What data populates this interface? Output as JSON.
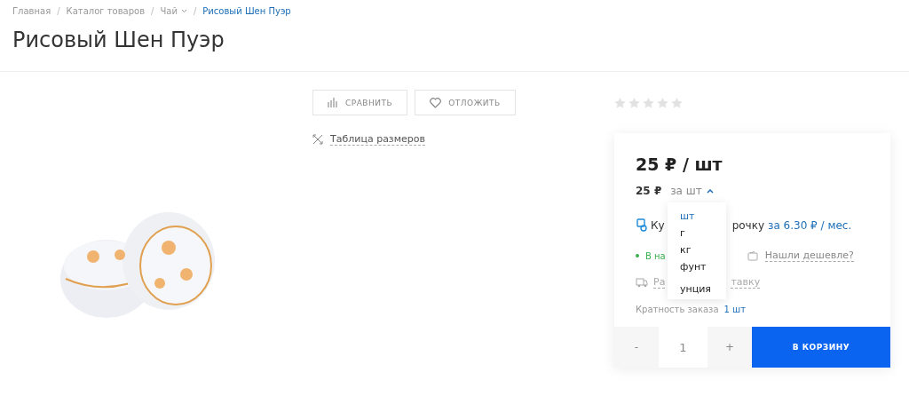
{
  "breadcrumb_separator": "/",
  "breadcrumbs": [
    {
      "label": "Главная",
      "current": false,
      "has_menu": false
    },
    {
      "label": "Каталог товаров",
      "current": false,
      "has_menu": false
    },
    {
      "label": "Чай",
      "current": false,
      "has_menu": true
    },
    {
      "label": "Рисовый Шен Пуэр",
      "current": true,
      "has_menu": false
    }
  ],
  "title": "Рисовый Шен Пуэр",
  "actions": [
    {
      "kind": "compare",
      "label": "СРАВНИТЬ"
    },
    {
      "kind": "favorite",
      "label": "ОТЛОЖИТЬ"
    }
  ],
  "size_table_link": "Таблица размеров",
  "rating": {
    "stars": 0
  },
  "price_card": {
    "price": "25 ₽ / шт",
    "unit_price": "25 ₽",
    "unit_selector": "за шт",
    "unit_dropdown": {
      "expanded": true,
      "options": [
        {
          "label": "шт",
          "selected": true
        },
        {
          "label": "г",
          "selected": false
        },
        {
          "label": "кг",
          "selected": false
        },
        {
          "label": "фунт",
          "selected": false
        },
        {
          "label": "унция",
          "selected": false
        }
      ]
    },
    "installment": {
      "text_start": "Ку",
      "text_end": "рочку",
      "link": "за 6.30 ₽ / мес."
    },
    "stock": {
      "text_start": "В на",
      "in_stock": true
    },
    "cheaper_link": "Нашли дешевле?",
    "delivery": {
      "text_start": "Ра",
      "text_end": "тавку"
    },
    "order_multiple": {
      "label": "Кратность заказа",
      "value": "1 шт"
    },
    "quantity": {
      "minus": "-",
      "value": "1",
      "plus": "+"
    },
    "cart_button": "В КОРЗИНУ"
  }
}
